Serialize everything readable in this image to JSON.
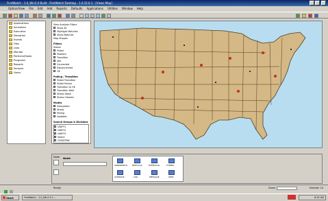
{
  "window": {
    "title": "FirstWatch - 1.0_Win2.0 Build - FirstWatch Desktop - 1.0.32.6.1 - [Views Map]"
  },
  "menu": [
    "Option/View",
    "File",
    "Edit",
    "Add",
    "Reports",
    "Defaults",
    "Applications",
    "Utilities",
    "Window",
    "Help"
  ],
  "tree": {
    "items": [
      "Applications",
      "Activation",
      "Executive",
      "Deviation",
      "Events",
      "Files",
      "Lists",
      "Monitor",
      "Partners/Hosts",
      "Programs",
      "Reports",
      "Sensors",
      "Users"
    ]
  },
  "filters": {
    "header_lines": [
      "View Analysis Filters",
      "Show All",
      "Highlight Matches",
      "Show Matches",
      "Map Shapes"
    ],
    "status_title": "Filters",
    "status_sub": "Status",
    "status_items": [
      "Failed",
      "Problem",
      "Transition",
      "Idle",
      "Connected",
      "Disconnected",
      "OK"
    ],
    "polling_title": "Polling / Transition",
    "polling_items": [
      "Failed Transition",
      "Failed Failure",
      "Transition to OK",
      "Transition Wait",
      "Stress Down",
      "Stress Cleared"
    ],
    "modes_title": "Modes",
    "modes_items": [
      "Subsystem",
      "Stress",
      "Polling",
      "Updated"
    ],
    "list_title": "Search Groups & Divisions",
    "list_items": [
      "UNIFY1",
      "UNIFY2",
      "UNIFY3",
      "Select",
      "CREDITBN"
    ]
  },
  "bottom": {
    "node_label": "Node",
    "icons": [
      "UNKNWN/TO",
      "REDUCAS",
      "EVENTLOG",
      "TTSERV",
      "CONSOLE",
      "LOG",
      "MESSAGE",
      "SERV"
    ]
  },
  "status": {
    "left": "Ready",
    "zoom_label": "Zoom",
    "right": "Number 14"
  },
  "taskbar": {
    "start": "Start",
    "app": "FirstWatch - 1.0_Win2.0 L...",
    "clock": "8:30 AM"
  },
  "colors": {
    "title_bg": "#0a246a",
    "map_land": "#d4b886",
    "map_water": "#b8ddf0",
    "border": "#808080"
  }
}
